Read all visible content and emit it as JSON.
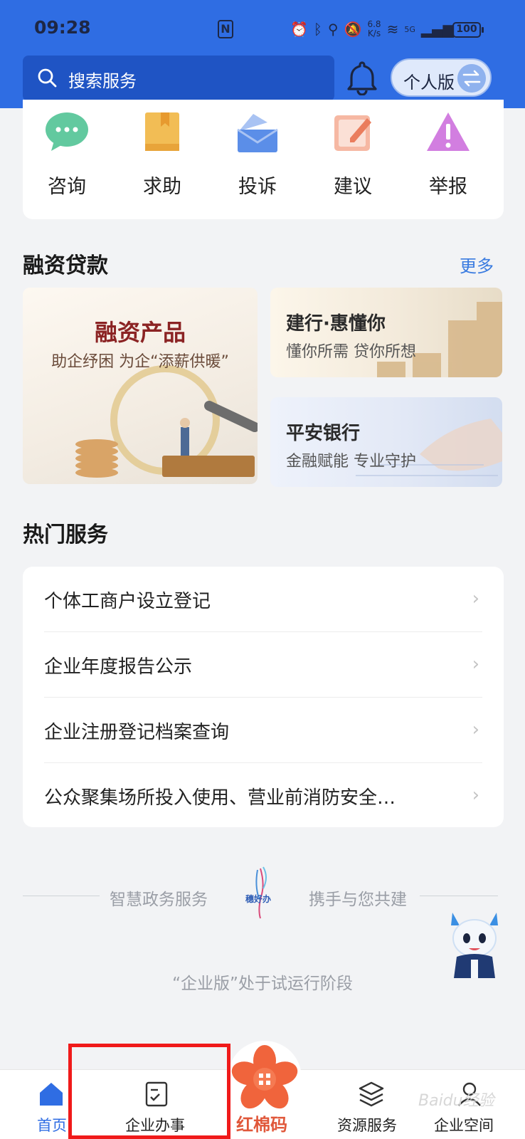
{
  "status_bar": {
    "time": "09:28",
    "nfc": "N",
    "speed": "6.8\nK/s",
    "network": "5G",
    "battery": "100"
  },
  "header": {
    "search_placeholder": "搜索服务",
    "version_label": "个人版"
  },
  "quick_actions": [
    {
      "label": "咨询",
      "icon": "chat-bubble-icon",
      "color": "#5cc59a"
    },
    {
      "label": "求助",
      "icon": "book-icon",
      "color": "#f0b64a"
    },
    {
      "label": "投诉",
      "icon": "envelope-icon",
      "color": "#5b8ee8"
    },
    {
      "label": "建议",
      "icon": "edit-note-icon",
      "color": "#ef8b6c"
    },
    {
      "label": "举报",
      "icon": "warning-icon",
      "color": "#c56fd8"
    }
  ],
  "finance": {
    "title": "融资贷款",
    "more": "更多",
    "big_card": {
      "title": "融资产品",
      "subtitle": "助企纾困 为企“添薪供暖”"
    },
    "cards": [
      {
        "title": "建行·惠懂你",
        "subtitle": "懂你所需 贷你所想"
      },
      {
        "title": "平安银行",
        "subtitle": "金融赋能 专业守护"
      }
    ]
  },
  "hot_services": {
    "title": "热门服务",
    "items": [
      "个体工商户设立登记",
      "企业年度报告公示",
      "企业注册登记档案查询",
      "公众聚集场所投入使用、营业前消防安全…"
    ]
  },
  "slogan": {
    "left": "智慧政务服务",
    "right": "携手与您共建",
    "logo_text": "穗好办"
  },
  "trial_notice": "“企业版”处于试运行阶段",
  "bottom_nav": {
    "items": [
      "首页",
      "企业办事",
      "资源服务",
      "企业空间"
    ],
    "center_label": "红棉码",
    "active_color": "#2f6de3",
    "center_color": "#f0643c"
  },
  "watermark": "Baidu经验"
}
